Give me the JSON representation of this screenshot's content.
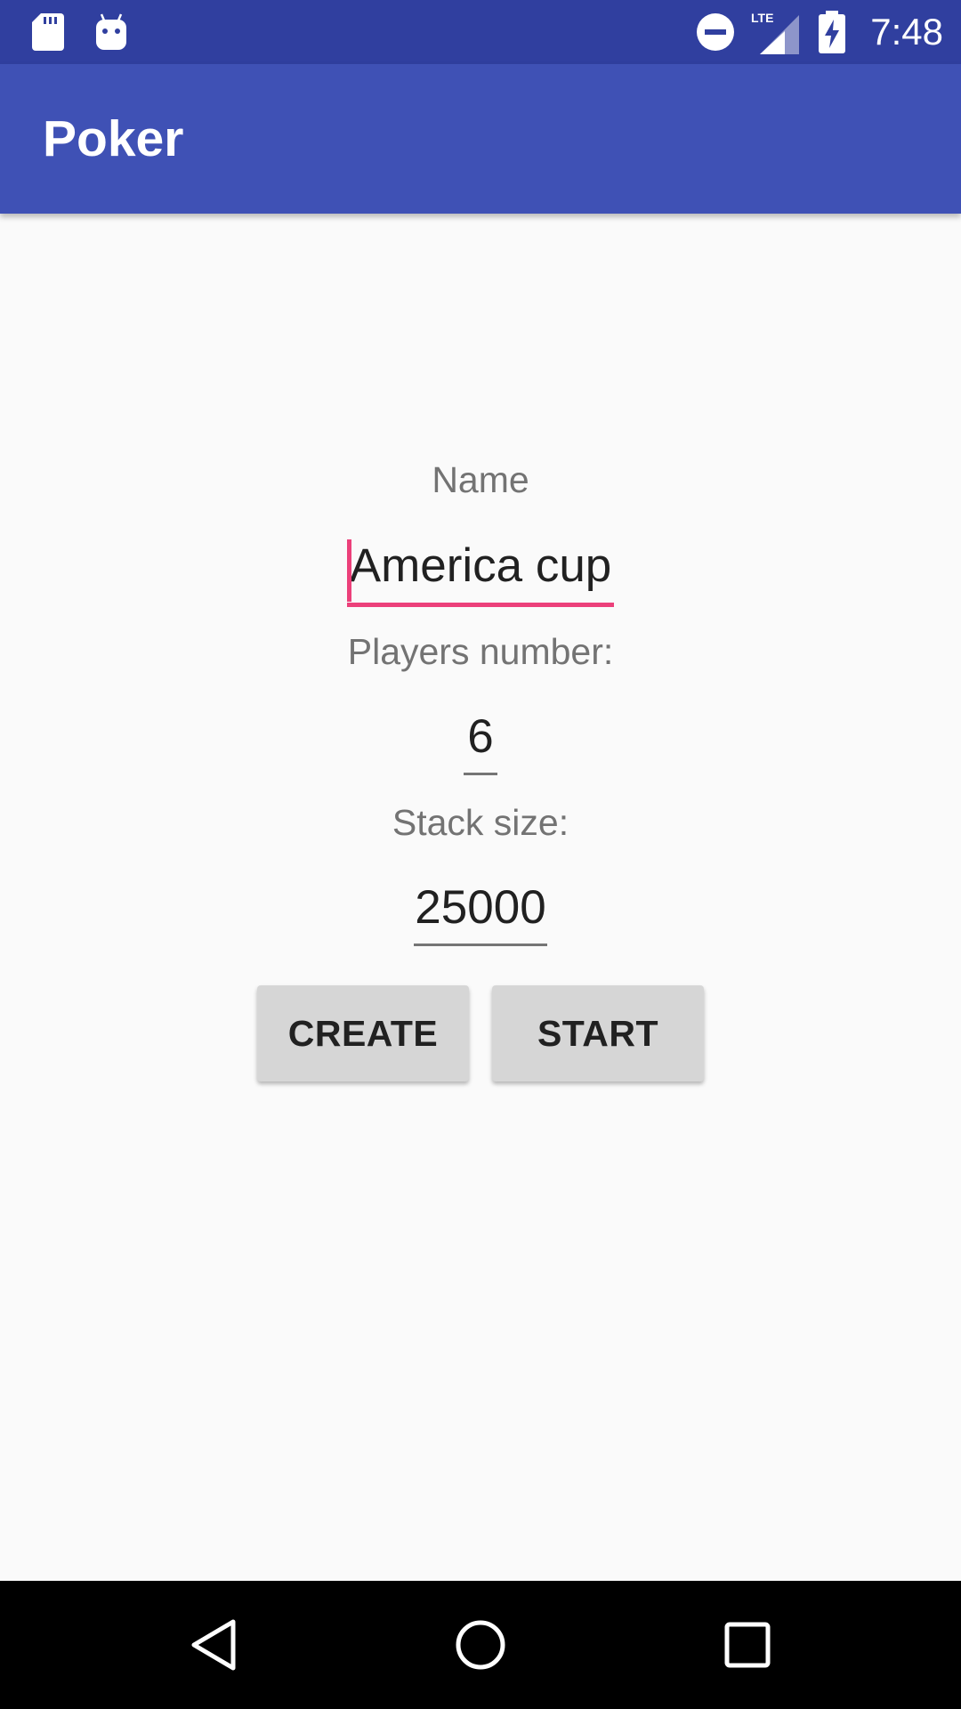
{
  "status_bar": {
    "time": "7:48",
    "icons": [
      "sd-card-icon",
      "android-icon",
      "do-not-disturb-icon",
      "lte-signal-icon",
      "battery-charging-icon"
    ],
    "network": "LTE",
    "color": "#303f9f"
  },
  "app_bar": {
    "title": "Poker",
    "color": "#3f51b5"
  },
  "form": {
    "name_label": "Name",
    "name_value": "America cup",
    "players_label": "Players number:",
    "players_value": "6",
    "stack_label": "Stack size:",
    "stack_value": "25000",
    "accent_color": "#ec407a"
  },
  "buttons": {
    "create_label": "CREATE",
    "start_label": "START"
  },
  "nav_bar": {
    "icons": [
      "back-icon",
      "home-icon",
      "recents-icon"
    ]
  }
}
